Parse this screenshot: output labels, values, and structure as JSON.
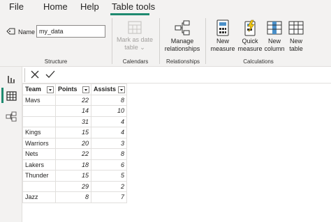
{
  "menu": {
    "tabs": [
      {
        "label": "File"
      },
      {
        "label": "Home"
      },
      {
        "label": "Help"
      },
      {
        "label": "Table tools"
      }
    ],
    "active_tab": "Table tools"
  },
  "ribbon": {
    "structure": {
      "name_label": "Name",
      "name_value": "my_data",
      "group_label": "Structure"
    },
    "calendars": {
      "mark_as_date_table_line1": "Mark as date",
      "mark_as_date_table_line2": "table",
      "group_label": "Calendars"
    },
    "relationships": {
      "manage_line1": "Manage",
      "manage_line2": "relationships",
      "group_label": "Relationships"
    },
    "calculations": {
      "new_measure_line1": "New",
      "new_measure_line2": "measure",
      "quick_measure_line1": "Quick",
      "quick_measure_line2": "measure",
      "new_column_line1": "New",
      "new_column_line2": "column",
      "new_table_line1": "New",
      "new_table_line2": "table",
      "group_label": "Calculations"
    }
  },
  "table": {
    "columns": [
      "Team",
      "Points",
      "Assists"
    ],
    "rows": [
      [
        "Mavs",
        "22",
        "8"
      ],
      [
        "",
        "14",
        "10"
      ],
      [
        "",
        "31",
        "4"
      ],
      [
        "Kings",
        "15",
        "4"
      ],
      [
        "Warriors",
        "20",
        "3"
      ],
      [
        "Nets",
        "22",
        "8"
      ],
      [
        "Lakers",
        "18",
        "6"
      ],
      [
        "Thunder",
        "15",
        "5"
      ],
      [
        "",
        "29",
        "2"
      ],
      [
        "Jazz",
        "8",
        "7"
      ]
    ]
  },
  "colors": {
    "accent": "#1f8a70",
    "ribbon_bg": "#f3f2f1"
  }
}
